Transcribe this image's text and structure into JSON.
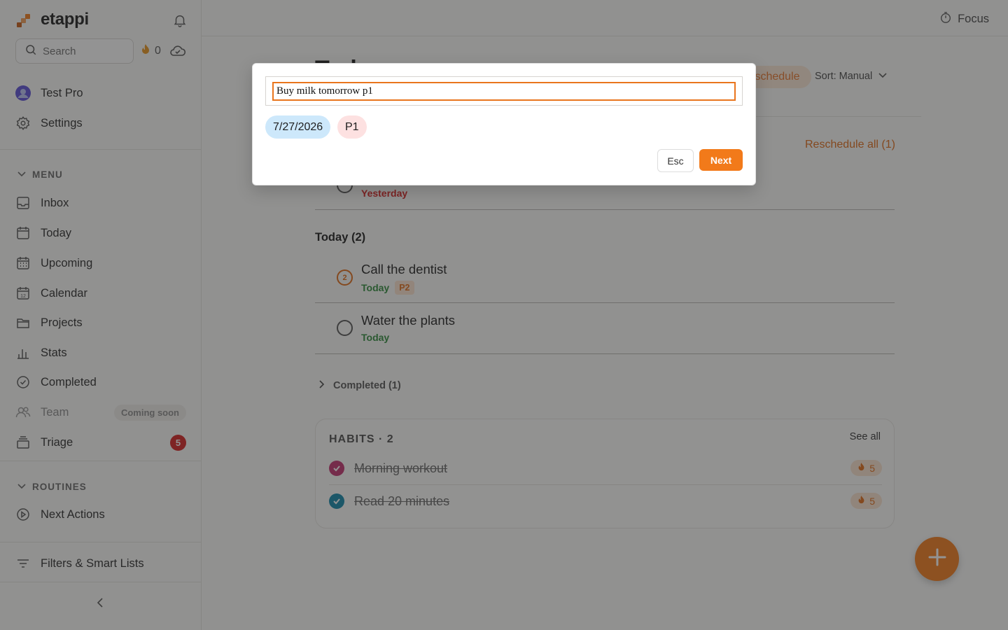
{
  "app": {
    "name": "etappi",
    "streak_count": "0"
  },
  "search": {
    "placeholder": "Search"
  },
  "account": {
    "user_label": "Test Pro",
    "settings_label": "Settings"
  },
  "menu": {
    "heading": "MENU",
    "items": [
      {
        "label": "Inbox",
        "icon": "inbox-icon"
      },
      {
        "label": "Today",
        "icon": "calendar-day-icon"
      },
      {
        "label": "Upcoming",
        "icon": "calendar-grid-icon"
      },
      {
        "label": "Calendar",
        "icon": "calendar-12-icon"
      },
      {
        "label": "Projects",
        "icon": "folder-icon"
      },
      {
        "label": "Stats",
        "icon": "bar-chart-icon"
      },
      {
        "label": "Completed",
        "icon": "check-circle-icon"
      },
      {
        "label": "Team",
        "icon": "team-icon",
        "badge": "Coming soon"
      },
      {
        "label": "Triage",
        "icon": "stack-icon",
        "count": "5"
      }
    ]
  },
  "routines": {
    "heading": "ROUTINES",
    "items": [
      {
        "label": "Next Actions",
        "icon": "play-circle-icon"
      }
    ]
  },
  "filters": {
    "label": "Filters & Smart Lists"
  },
  "topbar": {
    "focus_label": "Focus"
  },
  "main": {
    "title": "Today",
    "reschedule_chip": "Reschedule",
    "sort_label": "Sort: Manual",
    "reschedule_all": "Reschedule all (1)",
    "overdue_task_meta": "Yesterday",
    "today_group": "Today (2)",
    "tasks": [
      {
        "title": "Call the dentist",
        "date": "Today",
        "priority": "P2",
        "priority_number": "2"
      },
      {
        "title": "Water the plants",
        "date": "Today"
      }
    ],
    "completed_label": "Completed (1)"
  },
  "habits": {
    "title": "HABITS · 2",
    "see_all": "See all",
    "items": [
      {
        "name": "Morning workout",
        "streak": "5",
        "color": "#c2306e"
      },
      {
        "name": "Read 20 minutes",
        "streak": "5",
        "color": "#1186a8"
      }
    ]
  },
  "dialog": {
    "input_value": "Buy milk tomorrow p1",
    "date_chip": "7/27/2026",
    "priority_chip": "P1",
    "esc_label": "Esc",
    "next_label": "Next"
  },
  "colors": {
    "accent": "#f27a1a",
    "date_chip": "#cde8fb",
    "priority_chip": "#fde1e1",
    "today_green": "#2e8b3a",
    "overdue_red": "#d42020"
  }
}
